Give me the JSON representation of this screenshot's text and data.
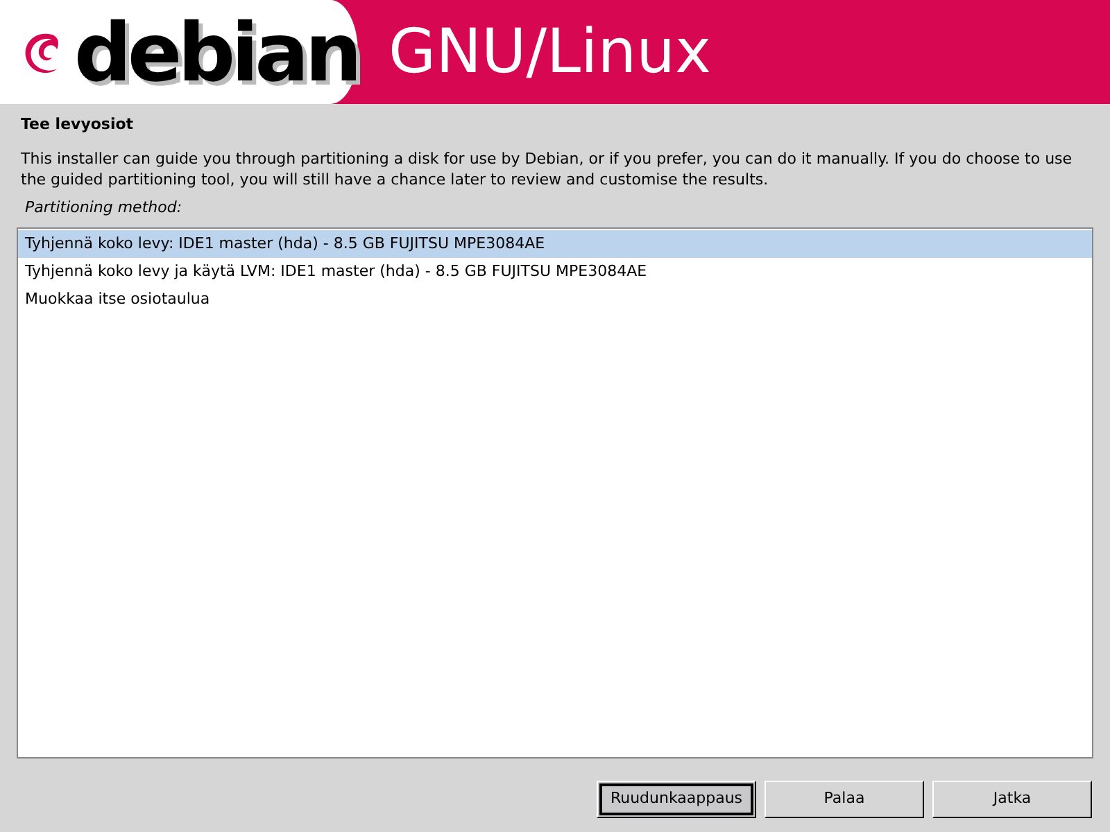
{
  "banner": {
    "logo_text": "debian",
    "title": "GNU/Linux"
  },
  "heading": "Tee levyosiot",
  "description": "This installer can guide you through partitioning a disk for use by Debian, or if you prefer, you can do it manually. If you do choose to use the guided partitioning tool, you will still have a chance later to review and customise the results.",
  "list_label": "Partitioning method:",
  "options": [
    {
      "label": "Tyhjennä koko levy: IDE1 master (hda) - 8.5 GB FUJITSU MPE3084AE",
      "selected": true
    },
    {
      "label": "Tyhjennä koko levy ja käytä LVM: IDE1 master (hda) - 8.5 GB FUJITSU MPE3084AE",
      "selected": false
    },
    {
      "label": "Muokkaa itse osiotaulua",
      "selected": false
    }
  ],
  "buttons": [
    {
      "label": "Ruudunkaappaus",
      "focused": true
    },
    {
      "label": "Palaa",
      "focused": false
    },
    {
      "label": "Jatka",
      "focused": false
    }
  ]
}
